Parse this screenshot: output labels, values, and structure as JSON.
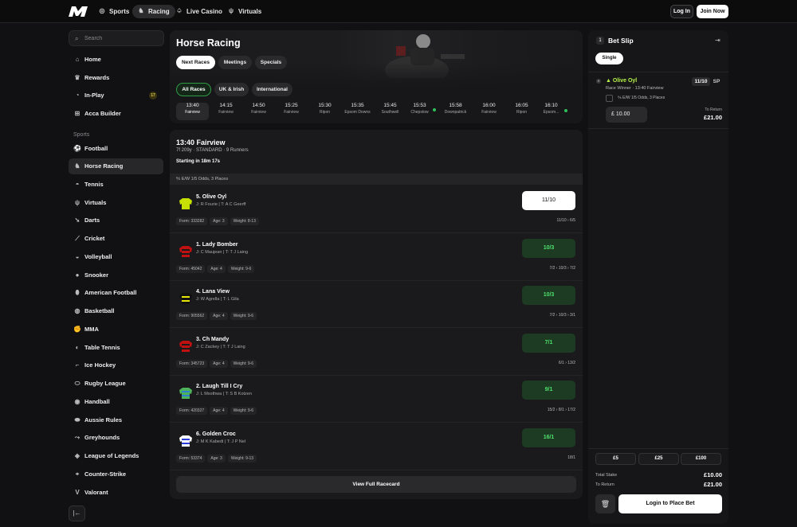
{
  "nav": {
    "tabs": [
      {
        "label": "Sports",
        "icon": "sports-icon"
      },
      {
        "label": "Racing",
        "icon": "horse-icon",
        "active": true
      },
      {
        "label": "Live Casino",
        "icon": "casino-icon"
      },
      {
        "label": "Virtuals",
        "icon": "virtuals-icon"
      }
    ],
    "login": "Log In",
    "join": "Join Now"
  },
  "sidebar": {
    "search_placeholder": "Search",
    "top_items": [
      {
        "label": "Home",
        "icon": "home-icon"
      },
      {
        "label": "Rewards",
        "icon": "rewards-icon"
      },
      {
        "label": "In-Play",
        "icon": "inplay-icon",
        "badge": "17"
      },
      {
        "label": "Acca Builder",
        "icon": "acca-icon"
      }
    ],
    "sports_heading": "Sports",
    "sports": [
      {
        "label": "Football",
        "icon": "football-icon"
      },
      {
        "label": "Horse Racing",
        "icon": "horse-icon",
        "active": true
      },
      {
        "label": "Tennis",
        "icon": "tennis-icon"
      },
      {
        "label": "Virtuals",
        "icon": "virtuals-icon"
      },
      {
        "label": "Darts",
        "icon": "darts-icon"
      },
      {
        "label": "Cricket",
        "icon": "cricket-icon"
      },
      {
        "label": "Volleyball",
        "icon": "volleyball-icon"
      },
      {
        "label": "Snooker",
        "icon": "snooker-icon"
      },
      {
        "label": "American Football",
        "icon": "american-football-icon"
      },
      {
        "label": "Basketball",
        "icon": "basketball-icon"
      },
      {
        "label": "MMA",
        "icon": "mma-icon"
      },
      {
        "label": "Table Tennis",
        "icon": "table-tennis-icon"
      },
      {
        "label": "Ice Hockey",
        "icon": "ice-hockey-icon"
      },
      {
        "label": "Rugby League",
        "icon": "rugby-icon"
      },
      {
        "label": "Handball",
        "icon": "handball-icon"
      },
      {
        "label": "Aussie Rules",
        "icon": "aussie-rules-icon"
      },
      {
        "label": "Greyhounds",
        "icon": "greyhound-icon"
      },
      {
        "label": "League of Legends",
        "icon": "lol-icon"
      },
      {
        "label": "Counter-Strike",
        "icon": "cs-icon"
      },
      {
        "label": "Valorant",
        "icon": "valorant-icon"
      }
    ]
  },
  "hero": {
    "title": "Horse Racing",
    "tabs": [
      "Next Races",
      "Meetings",
      "Specials"
    ],
    "filters": [
      "All Races",
      "UK & Irish",
      "International"
    ],
    "times": [
      {
        "time": "13:40",
        "course": "Fairview",
        "active": true
      },
      {
        "time": "14:15",
        "course": "Fairview"
      },
      {
        "time": "14:50",
        "course": "Fairview"
      },
      {
        "time": "15:25",
        "course": "Fairview"
      },
      {
        "time": "15:30",
        "course": "Ripon"
      },
      {
        "time": "15:35",
        "course": "Epsom Downs"
      },
      {
        "time": "15:45",
        "course": "Southwell"
      },
      {
        "time": "15:53",
        "course": "Chepstow",
        "live": true
      },
      {
        "time": "15:58",
        "course": "Downpatrick"
      },
      {
        "time": "16:00",
        "course": "Fairview"
      },
      {
        "time": "16:05",
        "course": "Ripon"
      },
      {
        "time": "16:10",
        "course": "Epsom...",
        "live": true
      }
    ]
  },
  "race": {
    "title": "13:40 Fairview",
    "meta": "7f 209y · STANDARD · 9 Runners",
    "starting": "Starting in 18m 17s",
    "ew_terms": "E/W 1/5 Odds, 3 Places",
    "runners": [
      {
        "name": "5. Olive Oyl",
        "jockey": "J: R Fourie | T: A C Geerff",
        "form": "Form: 333282",
        "age": "Age: 3",
        "weight": "Weight: 8-13",
        "odds": "11/10",
        "history": "11/10 › 6/5",
        "selected": true,
        "silk": [
          "#c8e000",
          "#c8e000"
        ]
      },
      {
        "name": "1. Lady Bomber",
        "jockey": "J: C Maujean | T: T J Laing",
        "form": "Form: 45042",
        "age": "Age: 4",
        "weight": "Weight: 9-6",
        "odds": "10/3",
        "history": "7/2 › 10/3 › 7/2",
        "silk": [
          "#c01010",
          "#1a1a1a"
        ]
      },
      {
        "name": "4. Lana View",
        "jockey": "J: W Agrella | T: L Gila",
        "form": "Form: 905562",
        "age": "Age: 4",
        "weight": "Weight: 9-6",
        "odds": "10/3",
        "history": "7/2 › 10/3 › 3/1",
        "silk": [
          "#111111",
          "#e6e600"
        ]
      },
      {
        "name": "3. Ch Mandy",
        "jockey": "J: C Zackey | T: T J Laing",
        "form": "Form: 345723",
        "age": "Age: 4",
        "weight": "Weight: 9-6",
        "odds": "7/1",
        "history": "6/1 › 13/2",
        "silk": [
          "#c01010",
          "#1a1a1a"
        ]
      },
      {
        "name": "2. Laugh Till I Cry",
        "jockey": "J: L Mxothwa | T: S B Kotzen",
        "form": "Form: 420327",
        "age": "Age: 4",
        "weight": "Weight: 9-6",
        "odds": "9/1",
        "history": "15/2 › 8/1 › 17/2",
        "silk": [
          "#4db35a",
          "#2f7fd0"
        ]
      },
      {
        "name": "6. Golden Croc",
        "jockey": "J: M K Kabedi | T: J P Nel",
        "form": "Form: 53374",
        "age": "Age: 3",
        "weight": "Weight: 9-13",
        "odds": "16/1",
        "history": "18/1",
        "silk": [
          "#ffffff",
          "#2b3fd8"
        ]
      }
    ],
    "view_full": "View Full Racecard"
  },
  "betslip": {
    "count": "1",
    "title": "Bet Slip",
    "single": "Single",
    "selection": "Olive Oyl",
    "market": "Race Winner · 13:40 Fairview",
    "odds": "11/10",
    "sp": "SP",
    "ew": "E/W 1/5 Odds, 3 Places",
    "stake": "£  10.00",
    "to_return_label": "To Return",
    "to_return": "£21.00",
    "quick": [
      "£5",
      "£25",
      "£100"
    ],
    "total_stake_label": "Total Stake",
    "total_stake": "£10.00",
    "total_return_label": "To Return",
    "total_return": "£21.00",
    "cta": "Login to Place Bet"
  }
}
